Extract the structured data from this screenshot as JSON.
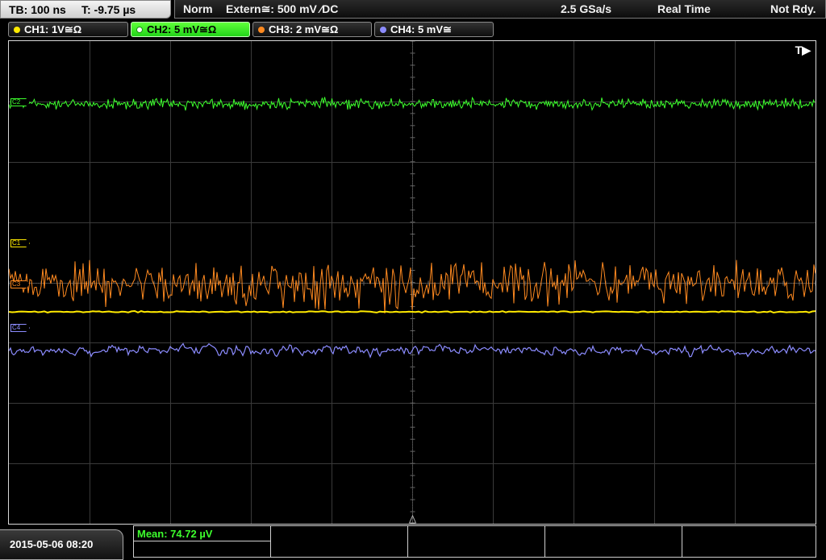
{
  "status": {
    "timebase": "TB: 100 ns",
    "trigger_time": "T: -9.75 µs",
    "mode": "Norm",
    "trigger_source": "Extern≅: 500 mV ⁄DC",
    "sample_rate": "2.5 GSa/s",
    "acquisition": "Real Time",
    "state": "Not Rdy."
  },
  "channels": [
    {
      "id": "ch1",
      "label": "CH1: 1V≅Ω",
      "color": "#ffea00",
      "marker": "C1"
    },
    {
      "id": "ch2",
      "label": "CH2: 5 mV≅Ω",
      "color": "#3dff2d",
      "marker": "C2"
    },
    {
      "id": "ch3",
      "label": "CH3: 2 mV≅Ω",
      "color": "#ff8a20",
      "marker": "C3"
    },
    {
      "id": "ch4",
      "label": "CH4: 5 mV≅",
      "color": "#8c8cff",
      "marker": "C4"
    }
  ],
  "trigger_marker": "T▶",
  "measurement": {
    "mean": "Mean: 74.72 µV"
  },
  "timestamp": "2015-05-06 08:20",
  "icons": {
    "channel_dot": "circle",
    "trigger_arrow": "triangle-right"
  }
}
